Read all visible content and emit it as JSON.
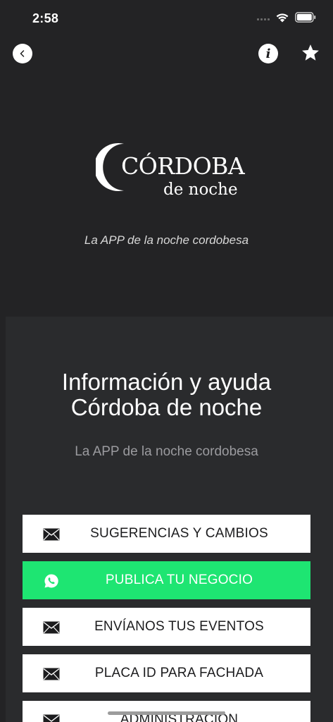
{
  "status": {
    "time": "2:58"
  },
  "nav": {
    "back_icon": "chevron-left-icon",
    "info_icon": "info-icon",
    "favorite_icon": "star-icon"
  },
  "logo": {
    "main": "CÓRDOBA",
    "sub": "de noche"
  },
  "hero": {
    "tagline": "La APP de la noche cordobesa"
  },
  "panel": {
    "title_line1": "Información y ayuda",
    "title_line2": "Córdoba de noche",
    "subtitle": "La APP de la noche cordobesa"
  },
  "menu": [
    {
      "label": "SUGERENCIAS Y CAMBIOS",
      "icon": "envelope-icon"
    },
    {
      "label": "PUBLICA TU NEGOCIO",
      "icon": "whatsapp-icon",
      "color": "#1ee572"
    },
    {
      "label": "ENVÍANOS TUS EVENTOS",
      "icon": "envelope-icon"
    },
    {
      "label": "PLACA ID PARA FACHADA",
      "icon": "envelope-icon"
    },
    {
      "label": "ADMINISTRACIÓN",
      "icon": "envelope-icon"
    }
  ]
}
